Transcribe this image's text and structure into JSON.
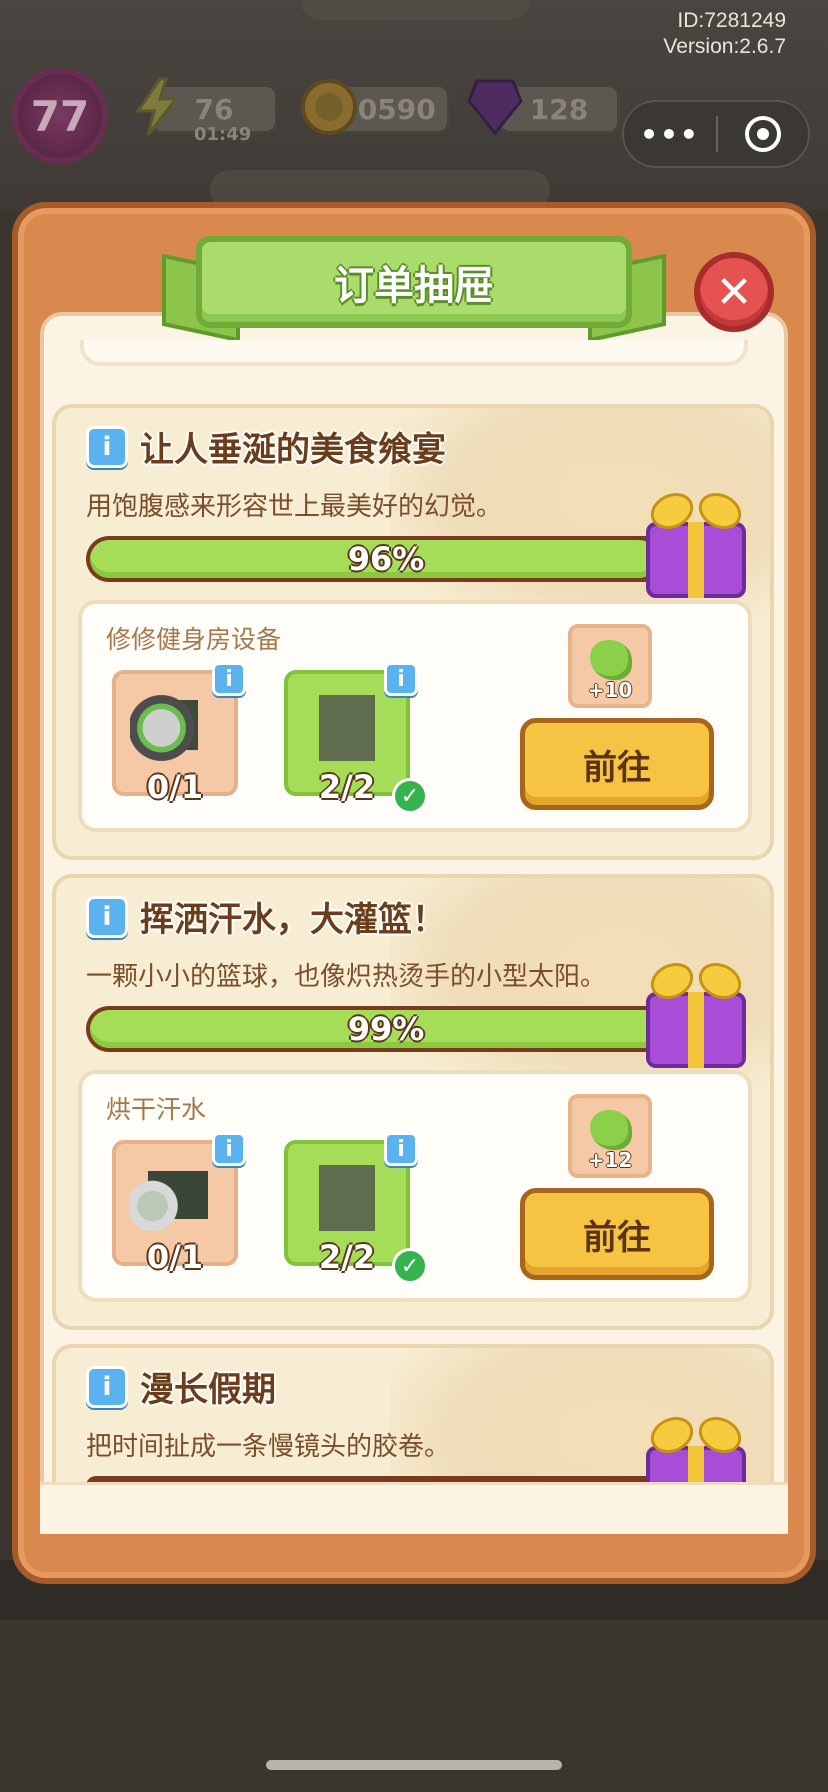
{
  "meta": {
    "id": "ID:7281249",
    "version": "Version:2.6.7"
  },
  "hud": {
    "level": "77",
    "energy": "76",
    "energy_timer": "01:49",
    "coins": "50590",
    "gems": "128",
    "capsule_more": "•••",
    "capsule_target_icon": "target-icon"
  },
  "dialog": {
    "title": "订单抽屉",
    "close_icon": "close-x-icon"
  },
  "orders": [
    {
      "title": "让人垂涎的美食飨宴",
      "description": "用饱腹感来形容世上最美好的幻觉。",
      "progress": 0.96,
      "progress_label": "96%",
      "task": {
        "title": "修修健身房设备",
        "items": [
          {
            "icon": "grinder-icon",
            "count": "0/1",
            "complete": false
          },
          {
            "icon": "glove-icon",
            "count": "2/2",
            "complete": true
          }
        ],
        "reward": "+10",
        "button": "前往"
      }
    },
    {
      "title": "挥洒汗水，大灌篮！",
      "description": "一颗小小的篮球，也像炽热烫手的小型太阳。",
      "progress": 0.99,
      "progress_label": "99%",
      "task": {
        "title": "烘干汗水",
        "items": [
          {
            "icon": "hair-dryer-icon",
            "count": "0/1",
            "complete": false
          },
          {
            "icon": "glove-icon",
            "count": "2/2",
            "complete": true
          }
        ],
        "reward": "+12",
        "button": "前往"
      }
    },
    {
      "title": "漫长假期",
      "description": "把时间扯成一条慢镜头的胶卷。"
    }
  ],
  "colors": {
    "panel": "#d9894e",
    "title_green": "#a9dc6b",
    "progress_green": "#a6dd58",
    "button_yellow": "#f6c343",
    "close_red": "#e65252",
    "info_blue": "#5ab3ef"
  }
}
